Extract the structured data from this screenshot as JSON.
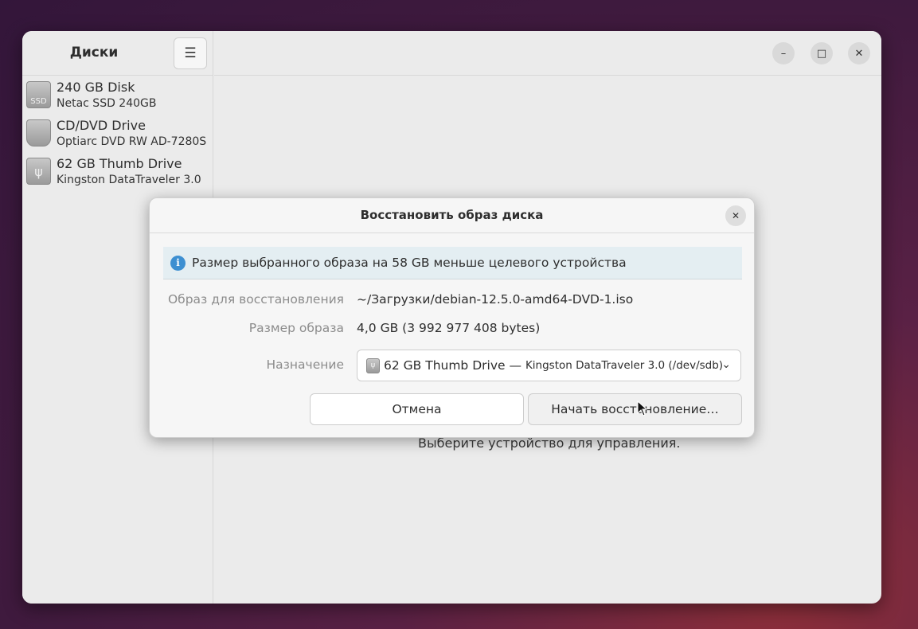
{
  "app": {
    "title": "Диски",
    "menu_icon": "hamburger-icon",
    "disks": [
      {
        "name": "240 GB Disk",
        "model": "Netac SSD 240GB",
        "icon": "ssd-icon",
        "icon_text": "SSD"
      },
      {
        "name": "CD/DVD Drive",
        "model": "Optiarc DVD RW AD-7280S",
        "icon": "optical-drive-icon",
        "icon_text": ""
      },
      {
        "name": "62 GB Thumb Drive",
        "model": "Kingston DataTraveler 3.0",
        "icon": "usb-drive-icon",
        "icon_text": "ψ"
      }
    ],
    "window_controls": {
      "minimize": "–",
      "maximize": "□",
      "close": "✕"
    },
    "empty_hint": "Выберите устройство для управления."
  },
  "dialog": {
    "title": "Восстановить образ диска",
    "close": "✕",
    "info_icon_glyph": "i",
    "info": "Размер выбранного образа на 58 GB меньше целевого устройства",
    "image_label": "Образ для восстановления",
    "image_value": "~/Загрузки/debian-12.5.0-amd64-DVD-1.iso",
    "size_label": "Размер образа",
    "size_value": "4,0 GB (3 992 977 408 bytes)",
    "dest_label": "Назначение",
    "dest_name": "62 GB Thumb Drive —",
    "dest_model": "Kingston DataTraveler 3.0 (/dev/sdb)",
    "dest_icon_glyph": "ψ",
    "chevron": "⌄",
    "cancel": "Отмена",
    "start": "Начать восстановление…"
  },
  "colors": {
    "accent_info": "#3d8fd1",
    "info_bg": "#e4eef2"
  }
}
